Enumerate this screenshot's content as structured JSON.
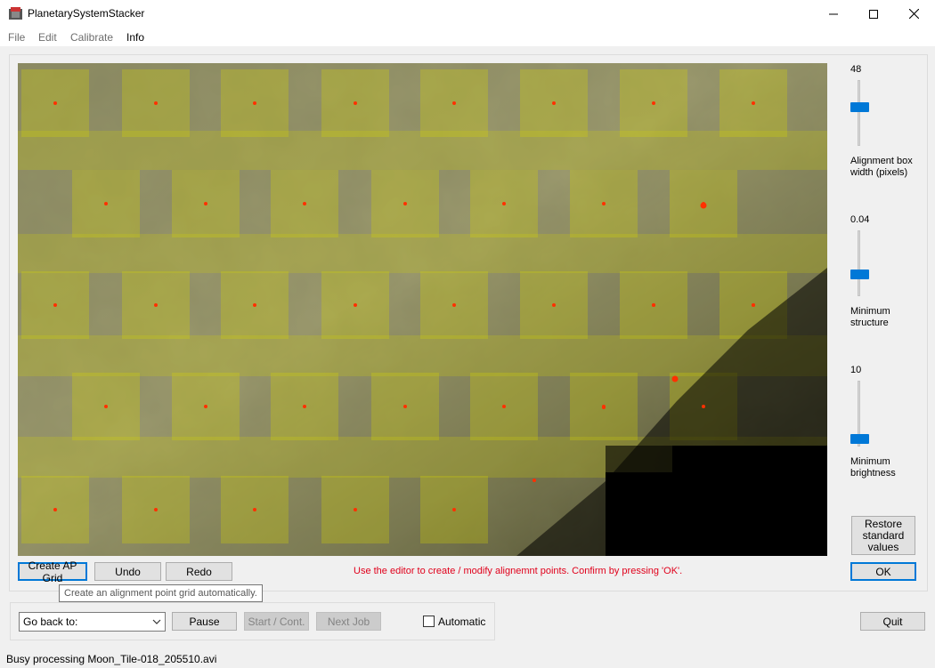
{
  "window": {
    "title": "PlanetarySystemStacker",
    "minimize_icon": "minimize-icon",
    "maximize_icon": "maximize-icon",
    "close_icon": "close-icon"
  },
  "menu": {
    "items": [
      {
        "label": "File"
      },
      {
        "label": "Edit"
      },
      {
        "label": "Calibrate"
      },
      {
        "label": "Info"
      }
    ]
  },
  "sliders": [
    {
      "value": "48",
      "label": "Alignment box width (pixels)",
      "level_fraction": 0.6
    },
    {
      "value": "0.04",
      "label": "Minimum structure",
      "level_fraction": 0.3
    },
    {
      "value": "10",
      "label": "Minimum brightness",
      "level_fraction": 0.05
    }
  ],
  "buttons": {
    "create_ap_grid": "Create AP Grid",
    "undo": "Undo",
    "redo": "Redo",
    "restore": "Restore standard values",
    "ok": "OK",
    "pause": "Pause",
    "start_cont": "Start / Cont.",
    "next_job": "Next Job",
    "quit": "Quit"
  },
  "tooltip": "Create an alignment point grid automatically.",
  "hint": "Use the editor to create / modify alignemnt points. Confirm by pressing 'OK'.",
  "go_back": {
    "selected": "Go back to:"
  },
  "automatic": {
    "label": "Automatic",
    "checked": false
  },
  "status": "Busy processing Moon_Tile-018_205510.avi",
  "colors": {
    "accent": "#0078d7",
    "hint_red": "#e0001b",
    "ap_box_yellow": "#d8d800",
    "ap_point": "#ff3000"
  }
}
